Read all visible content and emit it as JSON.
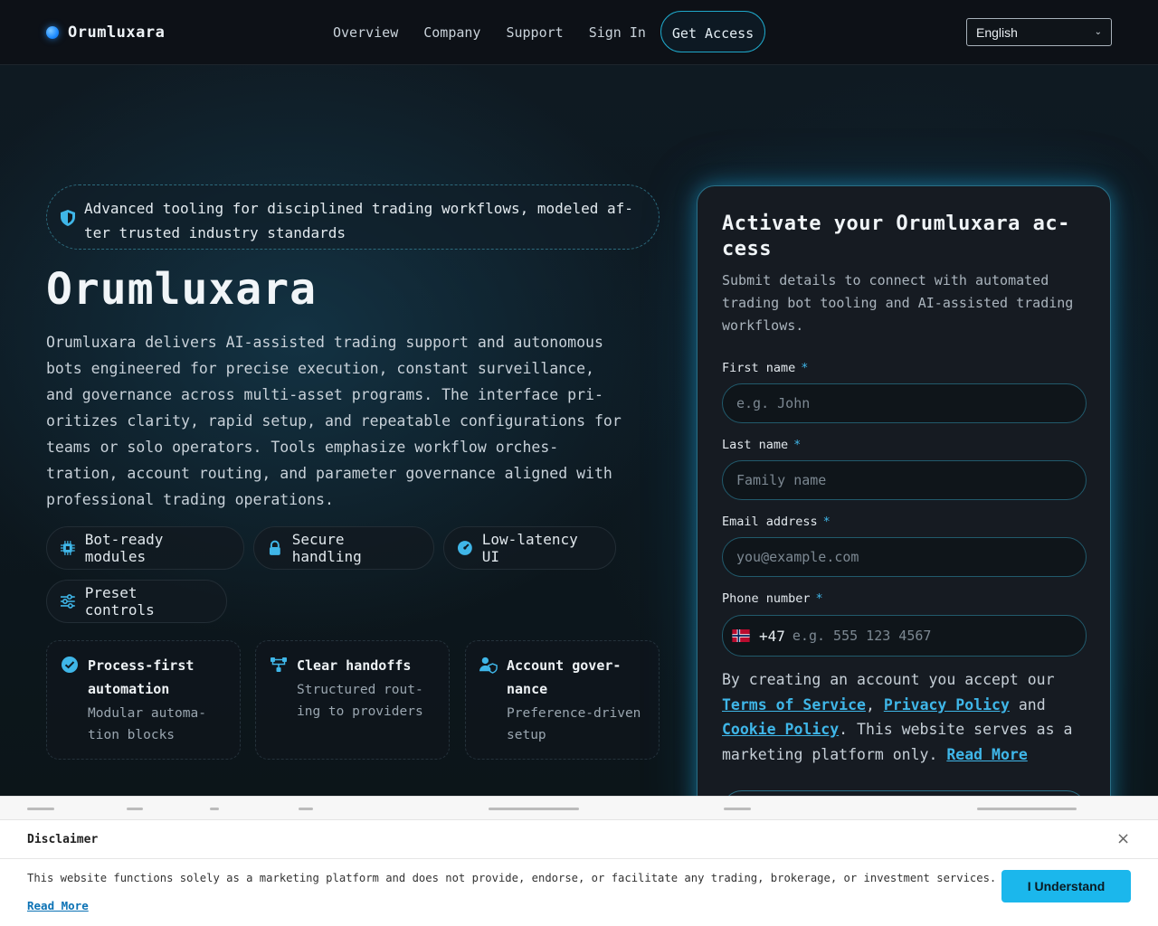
{
  "header": {
    "brand": "Orumluxara",
    "nav": [
      "Overview",
      "Company",
      "Support",
      "Sign In"
    ],
    "cta": "Get Access",
    "language": "English"
  },
  "hero": {
    "tagline": "Advanced tooling for disciplined trading workflows, modeled af-ter trusted industry standards",
    "title": "Orumluxara",
    "description": "Orumluxara delivers AI-assisted trading support and autonomous bots engineered for precise execution, constant surveillance, and governance across multi-asset programs. The interface pri-oritizes clarity, rapid setup, and repeatable configurations for teams or solo operators. Tools emphasize workflow orches-tration, account routing, and parameter governance aligned with professional trading operations.",
    "chips": [
      {
        "label": "Bot-ready modules",
        "icon": "chip-icon"
      },
      {
        "label": "Secure handling",
        "icon": "lock-icon"
      },
      {
        "label": "Low-latency UI",
        "icon": "speedometer-icon"
      },
      {
        "label": "Preset controls",
        "icon": "sliders-icon"
      }
    ],
    "features": [
      {
        "title": "Process-first automation",
        "desc": "Modular automa-tion blocks",
        "icon": "check-circle-icon"
      },
      {
        "title": "Clear handoffs",
        "desc": "Structured rout-ing to providers",
        "icon": "route-icon"
      },
      {
        "title": "Account gover-nance",
        "desc": "Preference-driven setup",
        "icon": "user-shield-icon"
      }
    ]
  },
  "form": {
    "title": "Activate your Orumluxara ac-cess",
    "subtitle": "Submit details to connect with automated trading bot tooling and AI-assisted trading workflows.",
    "fields": {
      "first_name": {
        "label": "First name",
        "placeholder": "e.g. John"
      },
      "last_name": {
        "label": "Last name",
        "placeholder": "Family name"
      },
      "email": {
        "label": "Email address",
        "placeholder": "you@example.com"
      },
      "phone": {
        "label": "Phone number",
        "country_code": "+47",
        "placeholder": "e.g. 555 123 4567"
      }
    },
    "required_mark": "*",
    "terms": {
      "prefix": "By creating an account you accept our",
      "terms_link": "Terms of Service",
      "privacy_link": "Privacy Policy",
      "and": "and",
      "cookie_link": "Cookie Policy",
      "suffix": ". This website serves as a marketing platform only.",
      "read_more": "Read More"
    }
  },
  "disclaimer": {
    "title": "Disclaimer",
    "text": "This website functions solely as a marketing platform and does not provide, endorse, or facilitate any trading, brokerage, or investment services.",
    "read_more": "Read More",
    "button": "I Understand",
    "close": "×"
  },
  "colors": {
    "accent": "#3fb6e8",
    "button": "#1bb7ec",
    "background": "#0b1218"
  }
}
